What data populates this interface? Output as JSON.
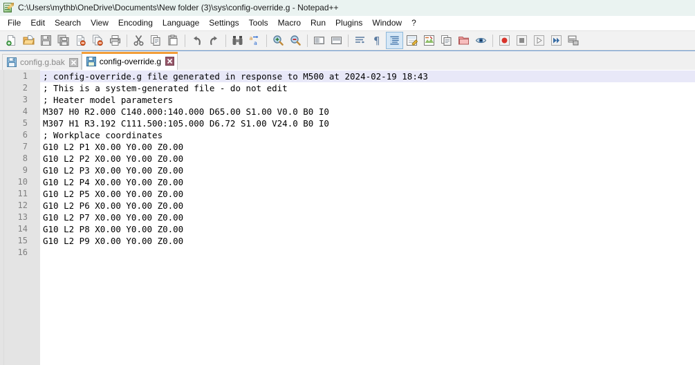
{
  "window": {
    "title": "C:\\Users\\mythb\\OneDrive\\Documents\\New folder (3)\\sys\\config-override.g - Notepad++",
    "app_icon": "notepad-plus-plus-icon"
  },
  "menu": {
    "items": [
      {
        "label": "File"
      },
      {
        "label": "Edit"
      },
      {
        "label": "Search"
      },
      {
        "label": "View"
      },
      {
        "label": "Encoding"
      },
      {
        "label": "Language"
      },
      {
        "label": "Settings"
      },
      {
        "label": "Tools"
      },
      {
        "label": "Macro"
      },
      {
        "label": "Run"
      },
      {
        "label": "Plugins"
      },
      {
        "label": "Window"
      },
      {
        "label": "?"
      }
    ]
  },
  "toolbar": {
    "groups": [
      [
        {
          "icon": "new-file-icon",
          "title": "New"
        },
        {
          "icon": "open-folder-icon",
          "title": "Open"
        },
        {
          "icon": "save-icon",
          "title": "Save"
        },
        {
          "icon": "save-all-icon",
          "title": "Save All"
        },
        {
          "icon": "close-file-icon",
          "title": "Close"
        },
        {
          "icon": "close-all-files-icon",
          "title": "Close All"
        },
        {
          "icon": "print-icon",
          "title": "Print"
        }
      ],
      [
        {
          "icon": "cut-scissors-icon",
          "title": "Cut"
        },
        {
          "icon": "copy-icon",
          "title": "Copy"
        },
        {
          "icon": "paste-icon",
          "title": "Paste"
        }
      ],
      [
        {
          "icon": "undo-arrow-icon",
          "title": "Undo"
        },
        {
          "icon": "redo-arrow-icon",
          "title": "Redo"
        }
      ],
      [
        {
          "icon": "find-binoculars-icon",
          "title": "Find"
        },
        {
          "icon": "replace-icon",
          "title": "Replace"
        }
      ],
      [
        {
          "icon": "zoom-in-icon",
          "title": "Zoom In"
        },
        {
          "icon": "zoom-out-icon",
          "title": "Zoom Out"
        }
      ],
      [
        {
          "icon": "sync-vertical-scroll-icon",
          "title": "Synchronize Vertical Scrolling"
        },
        {
          "icon": "sync-horizontal-scroll-icon",
          "title": "Synchronize Horizontal Scrolling"
        }
      ],
      [
        {
          "icon": "word-wrap-icon",
          "title": "Word wrap"
        },
        {
          "icon": "show-all-characters-icon",
          "title": "Show All Characters"
        },
        {
          "icon": "show-indent-guide-icon",
          "title": "Show Indent Guide",
          "active": true
        },
        {
          "icon": "user-defined-language-icon",
          "title": "User-Defined Dialogue"
        },
        {
          "icon": "document-map-icon",
          "title": "Document Map"
        },
        {
          "icon": "function-list-icon",
          "title": "Function List"
        },
        {
          "icon": "folder-workspace-icon",
          "title": "Folder as Workspace"
        },
        {
          "icon": "monitoring-eye-icon",
          "title": "Monitoring"
        }
      ],
      [
        {
          "icon": "record-macro-icon",
          "title": "Start Recording"
        },
        {
          "icon": "stop-recording-icon",
          "title": "Stop Recording"
        },
        {
          "icon": "play-macro-icon",
          "title": "Playback"
        },
        {
          "icon": "run-macro-multiple-icon",
          "title": "Run a Macro Multiple Times"
        },
        {
          "icon": "run-dialog-icon",
          "title": "Run"
        }
      ]
    ]
  },
  "tabs": [
    {
      "label": "config.g.bak",
      "active": false,
      "icon": "saved-document-icon",
      "close": "close-tab-icon"
    },
    {
      "label": "config-override.g",
      "active": true,
      "icon": "saved-document-icon",
      "close": "close-tab-icon"
    }
  ],
  "editor": {
    "line_numbers": [
      "1",
      "2",
      "3",
      "4",
      "5",
      "6",
      "7",
      "8",
      "9",
      "10",
      "11",
      "12",
      "13",
      "14",
      "15",
      "16"
    ],
    "current_line": 1,
    "lines": [
      {
        "n": 1,
        "text": "; config-override.g file generated in response to M500 at 2024-02-19 18:43",
        "comment": true
      },
      {
        "n": 2,
        "text": "; This is a system-generated file - do not edit",
        "comment": true
      },
      {
        "n": 3,
        "text": "; Heater model parameters",
        "comment": true
      },
      {
        "n": 4,
        "text": "M307 H0 R2.000 C140.000:140.000 D65.00 S1.00 V0.0 B0 I0",
        "comment": false
      },
      {
        "n": 5,
        "text": "M307 H1 R3.192 C111.500:105.000 D6.72 S1.00 V24.0 B0 I0",
        "comment": false
      },
      {
        "n": 6,
        "text": "; Workplace coordinates",
        "comment": true
      },
      {
        "n": 7,
        "text": "G10 L2 P1 X0.00 Y0.00 Z0.00",
        "comment": false
      },
      {
        "n": 8,
        "text": "G10 L2 P2 X0.00 Y0.00 Z0.00",
        "comment": false
      },
      {
        "n": 9,
        "text": "G10 L2 P3 X0.00 Y0.00 Z0.00",
        "comment": false
      },
      {
        "n": 10,
        "text": "G10 L2 P4 X0.00 Y0.00 Z0.00",
        "comment": false
      },
      {
        "n": 11,
        "text": "G10 L2 P5 X0.00 Y0.00 Z0.00",
        "comment": false
      },
      {
        "n": 12,
        "text": "G10 L2 P6 X0.00 Y0.00 Z0.00",
        "comment": false
      },
      {
        "n": 13,
        "text": "G10 L2 P7 X0.00 Y0.00 Z0.00",
        "comment": false
      },
      {
        "n": 14,
        "text": "G10 L2 P8 X0.00 Y0.00 Z0.00",
        "comment": false
      },
      {
        "n": 15,
        "text": "G10 L2 P9 X0.00 Y0.00 Z0.00",
        "comment": false
      },
      {
        "n": 16,
        "text": "",
        "comment": false
      }
    ]
  },
  "colors": {
    "titlebar_bg": "#eaf3f1",
    "toolbar_bg": "#f2f2f2",
    "gutter_bg": "#e4e4e4",
    "linenum_fg": "#808080",
    "current_line_bg": "#e8e8f8",
    "active_tab_accent": "#f29d38",
    "tabbar_top_line": "#6f9fd8",
    "code_fg": "#000000"
  }
}
